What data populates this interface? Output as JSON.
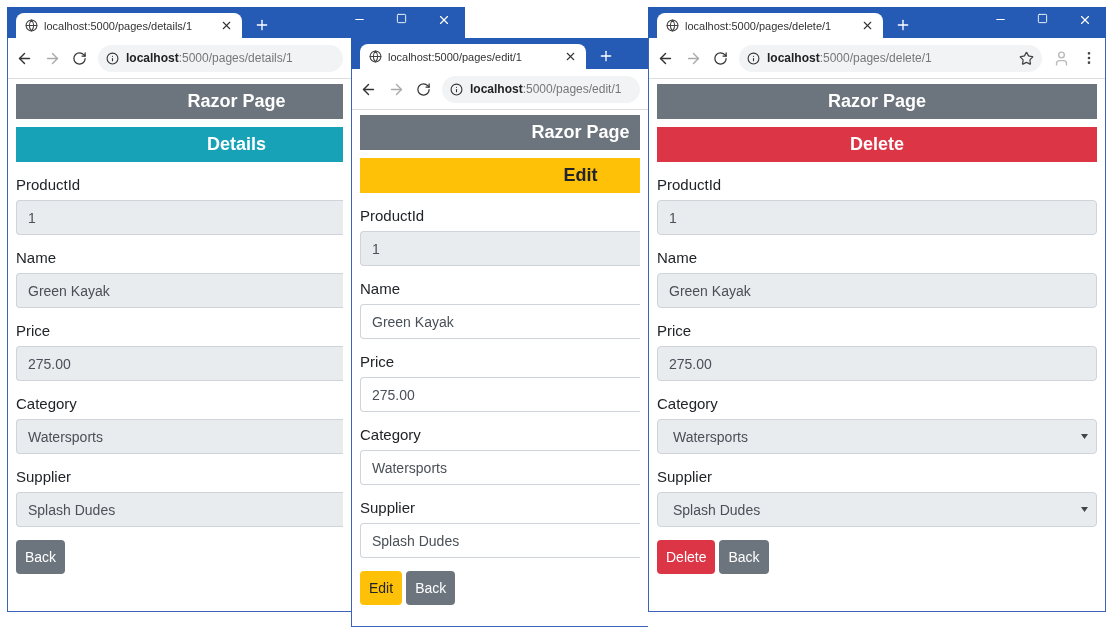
{
  "windows": [
    {
      "tab_title": "localhost:5000/pages/details/1",
      "address": "**localhost**:5000/pages/details/1",
      "header": "Razor Page",
      "banner": {
        "text": "Details",
        "kind": "info"
      },
      "fields": [
        {
          "label": "ProductId",
          "value": "1",
          "kind": "text",
          "readonly": true
        },
        {
          "label": "Name",
          "value": "Green Kayak",
          "kind": "text",
          "readonly": true
        },
        {
          "label": "Price",
          "value": "275.00",
          "kind": "text",
          "readonly": true
        },
        {
          "label": "Category",
          "value": "Watersports",
          "kind": "text",
          "readonly": true
        },
        {
          "label": "Supplier",
          "value": "Splash Dudes",
          "kind": "text",
          "readonly": true
        }
      ],
      "buttons": [
        {
          "label": "Back",
          "kind": "secondary"
        }
      ]
    },
    {
      "tab_title": "localhost:5000/pages/edit/1",
      "address": "**localhost**:5000/pages/edit/1",
      "header": "Razor Page",
      "banner": {
        "text": "Edit",
        "kind": "warning"
      },
      "fields": [
        {
          "label": "ProductId",
          "value": "1",
          "kind": "text",
          "readonly": true
        },
        {
          "label": "Name",
          "value": "Green Kayak",
          "kind": "text",
          "readonly": false
        },
        {
          "label": "Price",
          "value": "275.00",
          "kind": "text",
          "readonly": false
        },
        {
          "label": "Category",
          "value": "Watersports",
          "kind": "text",
          "readonly": false
        },
        {
          "label": "Supplier",
          "value": "Splash Dudes",
          "kind": "text",
          "readonly": false
        }
      ],
      "buttons": [
        {
          "label": "Edit",
          "kind": "warning"
        },
        {
          "label": "Back",
          "kind": "secondary"
        }
      ]
    },
    {
      "tab_title": "localhost:5000/pages/delete/1",
      "address": "**localhost**:5000/pages/delete/1",
      "header": "Razor Page",
      "banner": {
        "text": "Delete",
        "kind": "danger"
      },
      "fields": [
        {
          "label": "ProductId",
          "value": "1",
          "kind": "text",
          "readonly": true
        },
        {
          "label": "Name",
          "value": "Green Kayak",
          "kind": "text",
          "readonly": true
        },
        {
          "label": "Price",
          "value": "275.00",
          "kind": "text",
          "readonly": true
        },
        {
          "label": "Category",
          "value": "Watersports",
          "kind": "select",
          "readonly": true
        },
        {
          "label": "Supplier",
          "value": "Splash Dudes",
          "kind": "select",
          "readonly": true
        }
      ],
      "buttons": [
        {
          "label": "Delete",
          "kind": "danger"
        },
        {
          "label": "Back",
          "kind": "secondary"
        }
      ]
    }
  ]
}
